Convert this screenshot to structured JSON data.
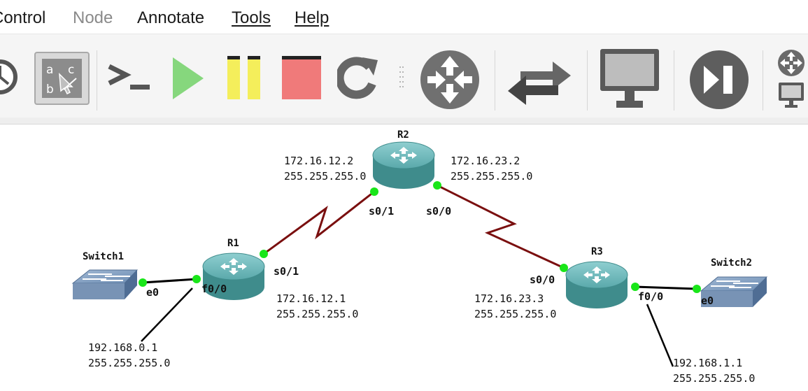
{
  "menubar": {
    "items": [
      {
        "label": "Control",
        "enabled": true
      },
      {
        "label": "Node",
        "enabled": false
      },
      {
        "label": "Annotate",
        "enabled": true
      },
      {
        "label": "Tools",
        "enabled": true
      },
      {
        "label": "Help",
        "enabled": true
      }
    ]
  },
  "toolbar": {
    "buttons": [
      {
        "icon": "clock-icon"
      },
      {
        "icon": "show-labels-icon",
        "active": true
      },
      {
        "icon": "console-icon"
      },
      {
        "icon": "play-icon",
        "color": "#86d77d"
      },
      {
        "icon": "pause-icon",
        "color": "#f4ee5b"
      },
      {
        "icon": "stop-icon",
        "color": "#f07a7a"
      },
      {
        "icon": "reload-icon"
      },
      {
        "icon": "router-icon"
      },
      {
        "icon": "switch-icon"
      },
      {
        "icon": "end-device-icon"
      },
      {
        "icon": "security-device-icon"
      },
      {
        "icon": "all-devices-icon"
      }
    ]
  },
  "topology": {
    "nodes": {
      "r1": {
        "name": "R1"
      },
      "r2": {
        "name": "R2"
      },
      "r3": {
        "name": "R3"
      },
      "switch1": {
        "name": "Switch1"
      },
      "switch2": {
        "name": "Switch2"
      }
    },
    "ports": {
      "r1_s01": "s0/1",
      "r1_f00": "f0/0",
      "r2_s01": "s0/1",
      "r2_s00": "s0/0",
      "r3_s00": "s0/0",
      "r3_f00": "f0/0",
      "sw1_e0": "e0",
      "sw2_e0": "e0"
    },
    "addresses": {
      "r2_left_ip": "172.16.12.2",
      "r2_left_mask": "255.255.255.0",
      "r2_right_ip": "172.16.23.2",
      "r2_right_mask": "255.255.255.0",
      "r1_s01_ip": "172.16.12.1",
      "r1_s01_mask": "255.255.255.0",
      "r3_s00_ip": "172.16.23.3",
      "r3_s00_mask": "255.255.255.0",
      "r1_f00_ip": "192.168.0.1",
      "r1_f00_mask": "255.255.255.0",
      "r3_f00_ip": "192.168.1.1",
      "r3_f00_mask": "255.255.255.0"
    },
    "colors": {
      "serial_link": "#7a0f0f",
      "ethernet_link": "#000000",
      "port_up": "#19e619",
      "router_body": "#3f8c8c"
    }
  }
}
